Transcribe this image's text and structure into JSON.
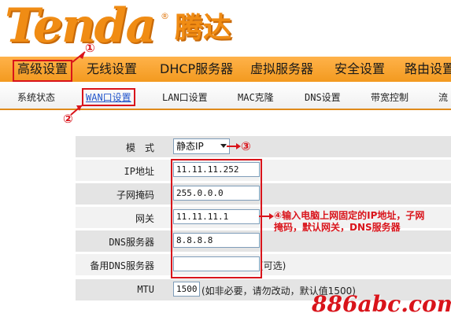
{
  "brand": {
    "logo_text": "Tenda",
    "logo_reg": "®",
    "logo_cn": "腾达"
  },
  "nav": {
    "items": [
      {
        "label": "高级设置",
        "active": true
      },
      {
        "label": "无线设置"
      },
      {
        "label": "DHCP服务器"
      },
      {
        "label": "虚拟服务器"
      },
      {
        "label": "安全设置"
      },
      {
        "label": "路由设置"
      }
    ]
  },
  "subnav": {
    "items": [
      {
        "label": "系统状态"
      },
      {
        "label": "WAN口设置",
        "active": true
      },
      {
        "label": "LAN口设置"
      },
      {
        "label": "MAC克隆"
      },
      {
        "label": "DNS设置"
      },
      {
        "label": "带宽控制"
      },
      {
        "label": "流"
      }
    ]
  },
  "form": {
    "mode": {
      "label": "模　式",
      "value": "静态IP"
    },
    "ip": {
      "label": "IP地址",
      "value": "11.11.11.252"
    },
    "mask": {
      "label": "子网掩码",
      "value": "255.0.0.0"
    },
    "gateway": {
      "label": "网关",
      "value": "11.11.11.1"
    },
    "dns": {
      "label": "DNS服务器",
      "value": "8.8.8.8"
    },
    "dns2": {
      "label": "备用DNS服务器",
      "value": "",
      "hint": "(可选)"
    },
    "mtu": {
      "label": "MTU",
      "value": "1500",
      "hint": "(如非必要，请勿改动，默认值1500)"
    }
  },
  "annotations": {
    "step1": "①",
    "step2": "②",
    "step3": "③",
    "step4_note": "④输入电脑上网固定的IP地址，子网掩码，默认网关，DNS服务器"
  },
  "watermark": "886abc.com",
  "colors": {
    "accent": "#f39a1f",
    "annotation": "#d9141b",
    "link": "#2255cc"
  }
}
